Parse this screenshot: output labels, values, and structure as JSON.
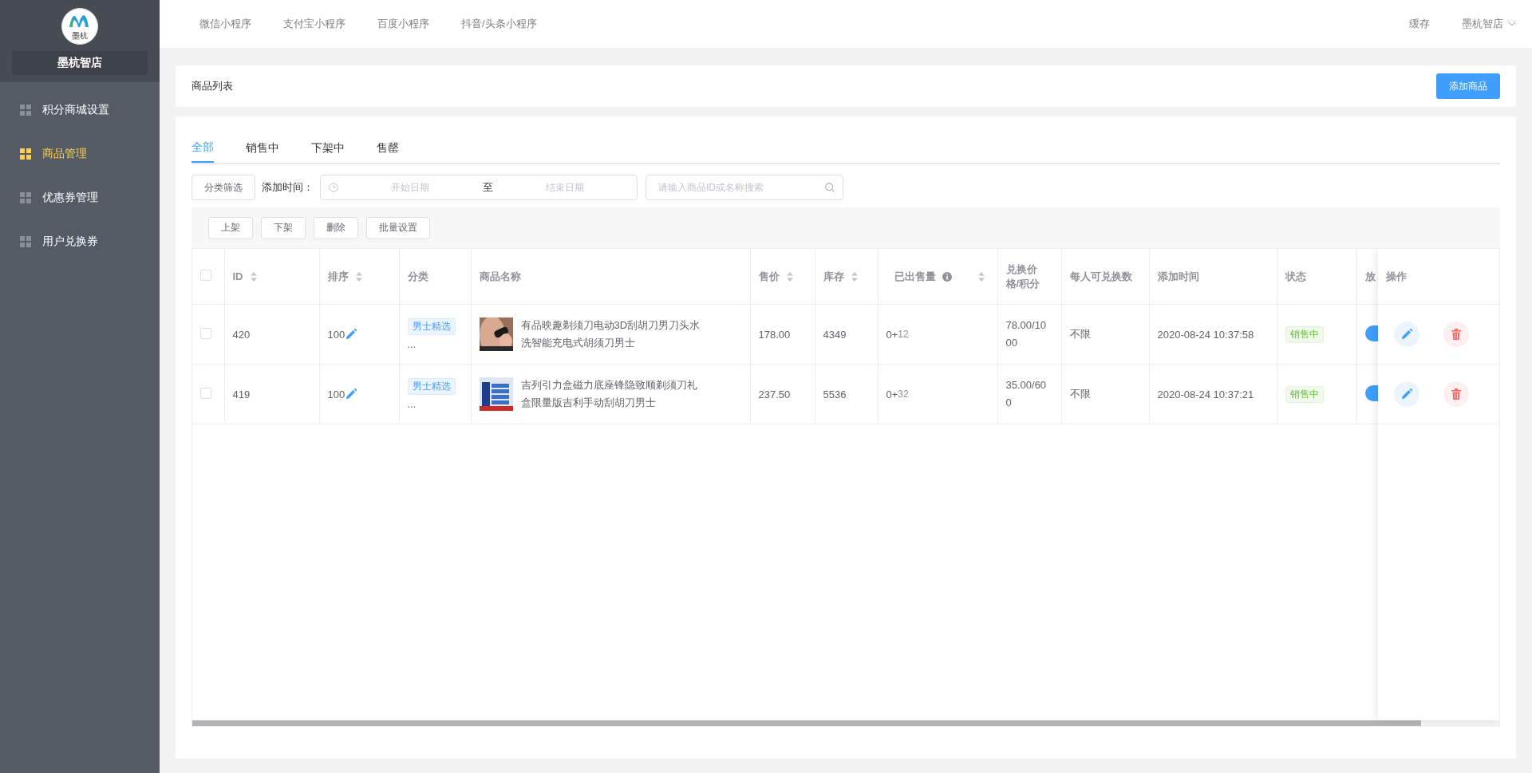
{
  "sidebar": {
    "logo_text": "墨杭",
    "store_name": "墨杭智店",
    "items": [
      {
        "label": "积分商城设置",
        "selected": false
      },
      {
        "label": "商品管理",
        "selected": true
      },
      {
        "label": "优惠券管理",
        "selected": false
      },
      {
        "label": "用户兑换券",
        "selected": false
      }
    ]
  },
  "top_bar": {
    "links": [
      "微信小程序",
      "支付宝小程序",
      "百度小程序",
      "抖音/头条小程序"
    ],
    "cache": "缓存",
    "account": "墨杭智店"
  },
  "page_header": {
    "title": "商品列表",
    "add_button": "添加商品"
  },
  "tabs": [
    {
      "label": "全部",
      "selected": true
    },
    {
      "label": "销售中",
      "selected": false
    },
    {
      "label": "下架中",
      "selected": false
    },
    {
      "label": "售罄",
      "selected": false
    }
  ],
  "filters": {
    "category_button": "分类筛选",
    "date_label": "添加时间：",
    "start_placeholder": "开始日期",
    "separator": "至",
    "end_placeholder": "结束日期",
    "search_placeholder": "请输入商品ID或名称搜索"
  },
  "bulk_actions": [
    "上架",
    "下架",
    "删除",
    "批量设置"
  ],
  "table": {
    "select_all": {
      "checked": false
    },
    "columns": [
      {
        "label": "ID",
        "sortable": true,
        "info": false
      },
      {
        "label": "排序",
        "sortable": true,
        "info": false
      },
      {
        "label": "分类",
        "sortable": false,
        "info": false
      },
      {
        "label": "商品名称",
        "sortable": false,
        "info": false
      },
      {
        "label": "售价",
        "sortable": true,
        "info": false
      },
      {
        "label": "库存",
        "sortable": true,
        "info": false
      },
      {
        "label": "已出售量",
        "sortable": true,
        "info": true
      },
      {
        "label": "兑换价格/积分",
        "sortable": false,
        "info": false
      },
      {
        "label": "每人可兑换数",
        "sortable": false,
        "info": false
      },
      {
        "label": "添加时间",
        "sortable": false,
        "info": false
      },
      {
        "label": "状态",
        "sortable": false,
        "info": false
      },
      {
        "label": "放"
      }
    ],
    "actions_column": "操作",
    "rows": [
      {
        "checked": false,
        "id": "420",
        "sort": "100",
        "category": "男士精选",
        "category_more": "...",
        "name": "有品映趣剃须刀电动3D刮胡刀男刀头水洗智能充电式胡须刀男士",
        "price": "178.00",
        "stock": "4349",
        "sold_base": "0+",
        "sold_extra": "12",
        "exchange": "78.00/1000",
        "limit": "不限",
        "added": "2020-08-24 10:37:58",
        "status": "销售中",
        "placed": true
      },
      {
        "checked": false,
        "id": "419",
        "sort": "100",
        "category": "男士精选",
        "category_more": "...",
        "name": "吉列引力盒磁力底座锋隐致顺剃须刀礼盒限量版吉利手动刮胡刀男士",
        "price": "237.50",
        "stock": "5536",
        "sold_base": "0+",
        "sold_extra": "32",
        "exchange": "35.00/600",
        "limit": "不限",
        "added": "2020-08-24 10:37:21",
        "status": "销售中",
        "placed": true
      }
    ]
  }
}
